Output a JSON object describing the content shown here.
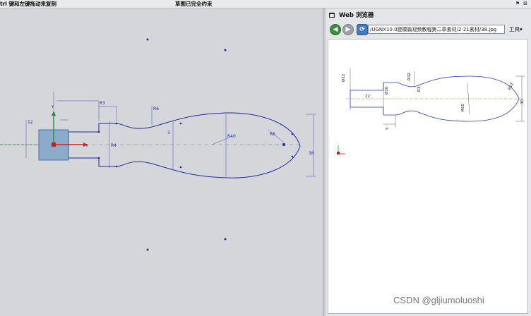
{
  "statusbar": {
    "hint": "trl 键和左键拖动来复制",
    "sketch_status": "草图已完全约束"
  },
  "browser": {
    "title": "Web 浏览器",
    "url": "/UGNX10.0建模篇视频教程第二章素材/2-21素材/38.jpg",
    "tools_label": "工具"
  },
  "sketch": {
    "dimensions": [
      "R3",
      "R6",
      "R40",
      "R6",
      "R4",
      "38",
      "12",
      "3"
    ]
  },
  "reference": {
    "dimensions": [
      "Ø12",
      "R42",
      "R3",
      "22",
      "Ø20",
      "R60",
      "R12",
      "30",
      "5"
    ]
  },
  "watermark": "CSDN @gljiumoluoshi",
  "colors": {
    "sketch_curve": "#1c2bb0",
    "centerline": "#7a7a8a",
    "selection_fill": "#7fa3c8",
    "axis_x": "#d32020",
    "axis_y": "#1f8f3a"
  }
}
